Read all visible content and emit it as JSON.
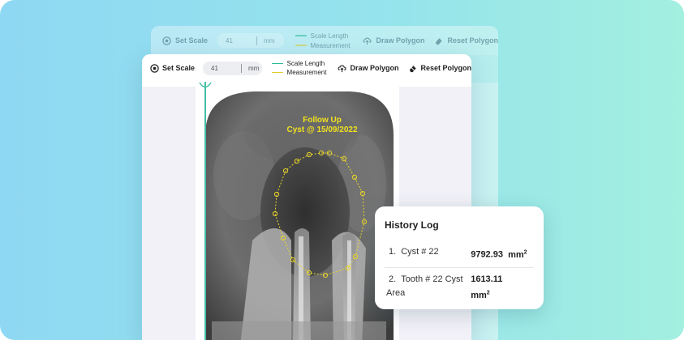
{
  "toolbar": {
    "set_scale_label": "Set Scale",
    "scale_value": "41",
    "scale_unit": "mm",
    "legend": [
      {
        "label": "Scale Length",
        "color": "#2fb89a"
      },
      {
        "label": "Measurement",
        "color": "#e3cc2e"
      }
    ],
    "draw_polygon_label": "Draw Polygon",
    "reset_polygon_label": "Reset Polygon"
  },
  "annotation": {
    "line1": "Follow Up",
    "line2": "Cyst @ 15/09/2022",
    "color": "#f2e21e"
  },
  "history": {
    "title": "History Log",
    "items": [
      {
        "number": "1.",
        "label": "Cyst # 22",
        "value": "9792.93",
        "unit": "mm",
        "exp": "2"
      },
      {
        "number": "2.",
        "label": "Tooth # 22 Cyst Area",
        "value": "1613.11",
        "unit": "mm",
        "exp": "2"
      }
    ]
  },
  "colors": {
    "accent_teal": "#45bfa6",
    "measurement_yellow": "#e3cc2e",
    "background_gradient": [
      "#8fd8f3",
      "#a3efe0"
    ]
  }
}
